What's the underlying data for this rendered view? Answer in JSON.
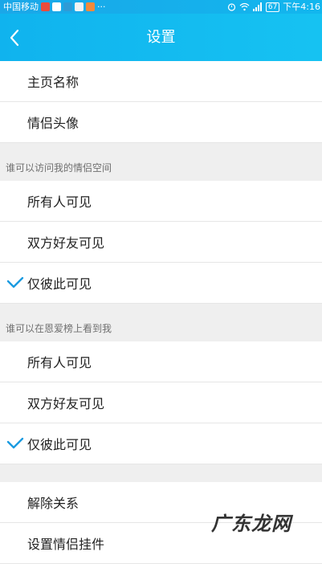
{
  "status_bar": {
    "carrier": "中国移动",
    "more": "···",
    "battery": "67",
    "time": "下午4:16"
  },
  "header": {
    "title": "设置"
  },
  "top_items": [
    {
      "label": "主页名称"
    },
    {
      "label": "情侣头像"
    }
  ],
  "visibility_section": {
    "title": "谁可以访问我的情侣空间",
    "options": [
      {
        "label": "所有人可见",
        "selected": false
      },
      {
        "label": "双方好友可见",
        "selected": false
      },
      {
        "label": "仅彼此可见",
        "selected": true
      }
    ]
  },
  "ranking_section": {
    "title": "谁可以在恩爱榜上看到我",
    "options": [
      {
        "label": "所有人可见",
        "selected": false
      },
      {
        "label": "双方好友可见",
        "selected": false
      },
      {
        "label": "仅彼此可见",
        "selected": true
      }
    ]
  },
  "bottom_items": [
    {
      "label": "解除关系"
    },
    {
      "label": "设置情侣挂件"
    }
  ],
  "watermark": "广东龙网",
  "colors": {
    "accent": "#12b6ee",
    "check": "#1b9be0"
  }
}
